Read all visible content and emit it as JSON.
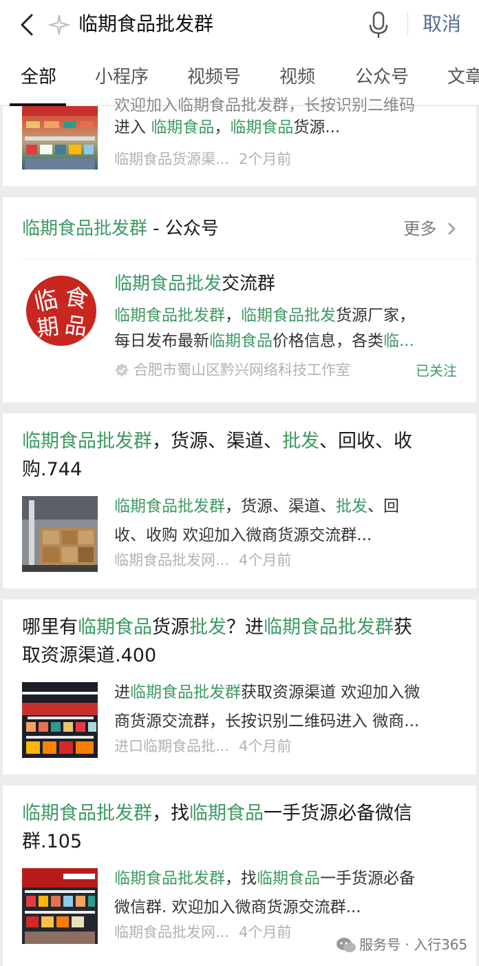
{
  "search": {
    "query": "临期食品批发群",
    "cancel_label": "取消"
  },
  "tabs": [
    {
      "label": "全部"
    },
    {
      "label": "小程序"
    },
    {
      "label": "视频号"
    },
    {
      "label": "视频"
    },
    {
      "label": "公众号"
    },
    {
      "label": "文章"
    }
  ],
  "result0": {
    "snippet_top": "欢迎加入临期食品批发群，长按识别二维码",
    "snippet_a": "进入 ",
    "snippet_b": "临期食品",
    "snippet_c": "，",
    "snippet_d": "临期食品",
    "snippet_e": "货源...",
    "source": "临期食品货源渠...",
    "time": "2个月前"
  },
  "official_account": {
    "header_hl": "临期食品批发群",
    "header_rest": " - 公众号",
    "more_label": "更多",
    "name_hl": "临期食品批发",
    "name_rest": "交流群",
    "desc_1": "临期食品批发群",
    "desc_2": "，",
    "desc_3": "临期食品批发",
    "desc_4": "货源厂家，",
    "desc_5": "每日发布最新",
    "desc_6": "临期食品",
    "desc_7": "价格信息，各类",
    "desc_8": "临...",
    "verified_by": "合肥市蜀山区黔兴网络科技工作室",
    "followed_label": "已关注",
    "logo_chars": [
      "临",
      "食",
      "期",
      "品"
    ]
  },
  "result1": {
    "title_1": "临期食品批发群",
    "title_2": "，货源、渠道、",
    "title_3": "批发",
    "title_4": "、回收、收",
    "title_5": "购.744",
    "snip_1": "临期食品批发群",
    "snip_2": "，货源、渠道、",
    "snip_3": "批发",
    "snip_4": "、回",
    "snip_5": "收、收购 欢迎加入微商货源交流群...",
    "source": "临期食品批发网...",
    "time": "4个月前"
  },
  "result2": {
    "title_1": "哪里有",
    "title_2": "临期食品",
    "title_3": "货源",
    "title_4": "批发",
    "title_5": "？进",
    "title_6": "临期食品批发群",
    "title_7": "获",
    "title_8": "取资源渠道.400",
    "snip_1": "进",
    "snip_2": "临期食品批发群",
    "snip_3": "获取资源渠道 欢迎加入微",
    "snip_4": "商货源交流群，长按识别二维码进入 微商...",
    "source": "进口临期食品批...",
    "time": "4个月前"
  },
  "result3": {
    "title_1": "临期食品批发群",
    "title_2": "，找",
    "title_3": "临期食品",
    "title_4": "一手货源必备微信",
    "title_5": "群.105",
    "snip_1": "临期食品批发群",
    "snip_2": "，找",
    "snip_3": "临期食品",
    "snip_4": "一手货源必备",
    "snip_5": "微信群. 欢迎加入微商货源交流群...",
    "source": "临期食品批发网...",
    "time": "4个月前"
  },
  "watermark": "服务号 · 入行365",
  "colors": {
    "highlight": "#3e9a62",
    "link": "#576b95",
    "logo_red": "#c8261e"
  }
}
